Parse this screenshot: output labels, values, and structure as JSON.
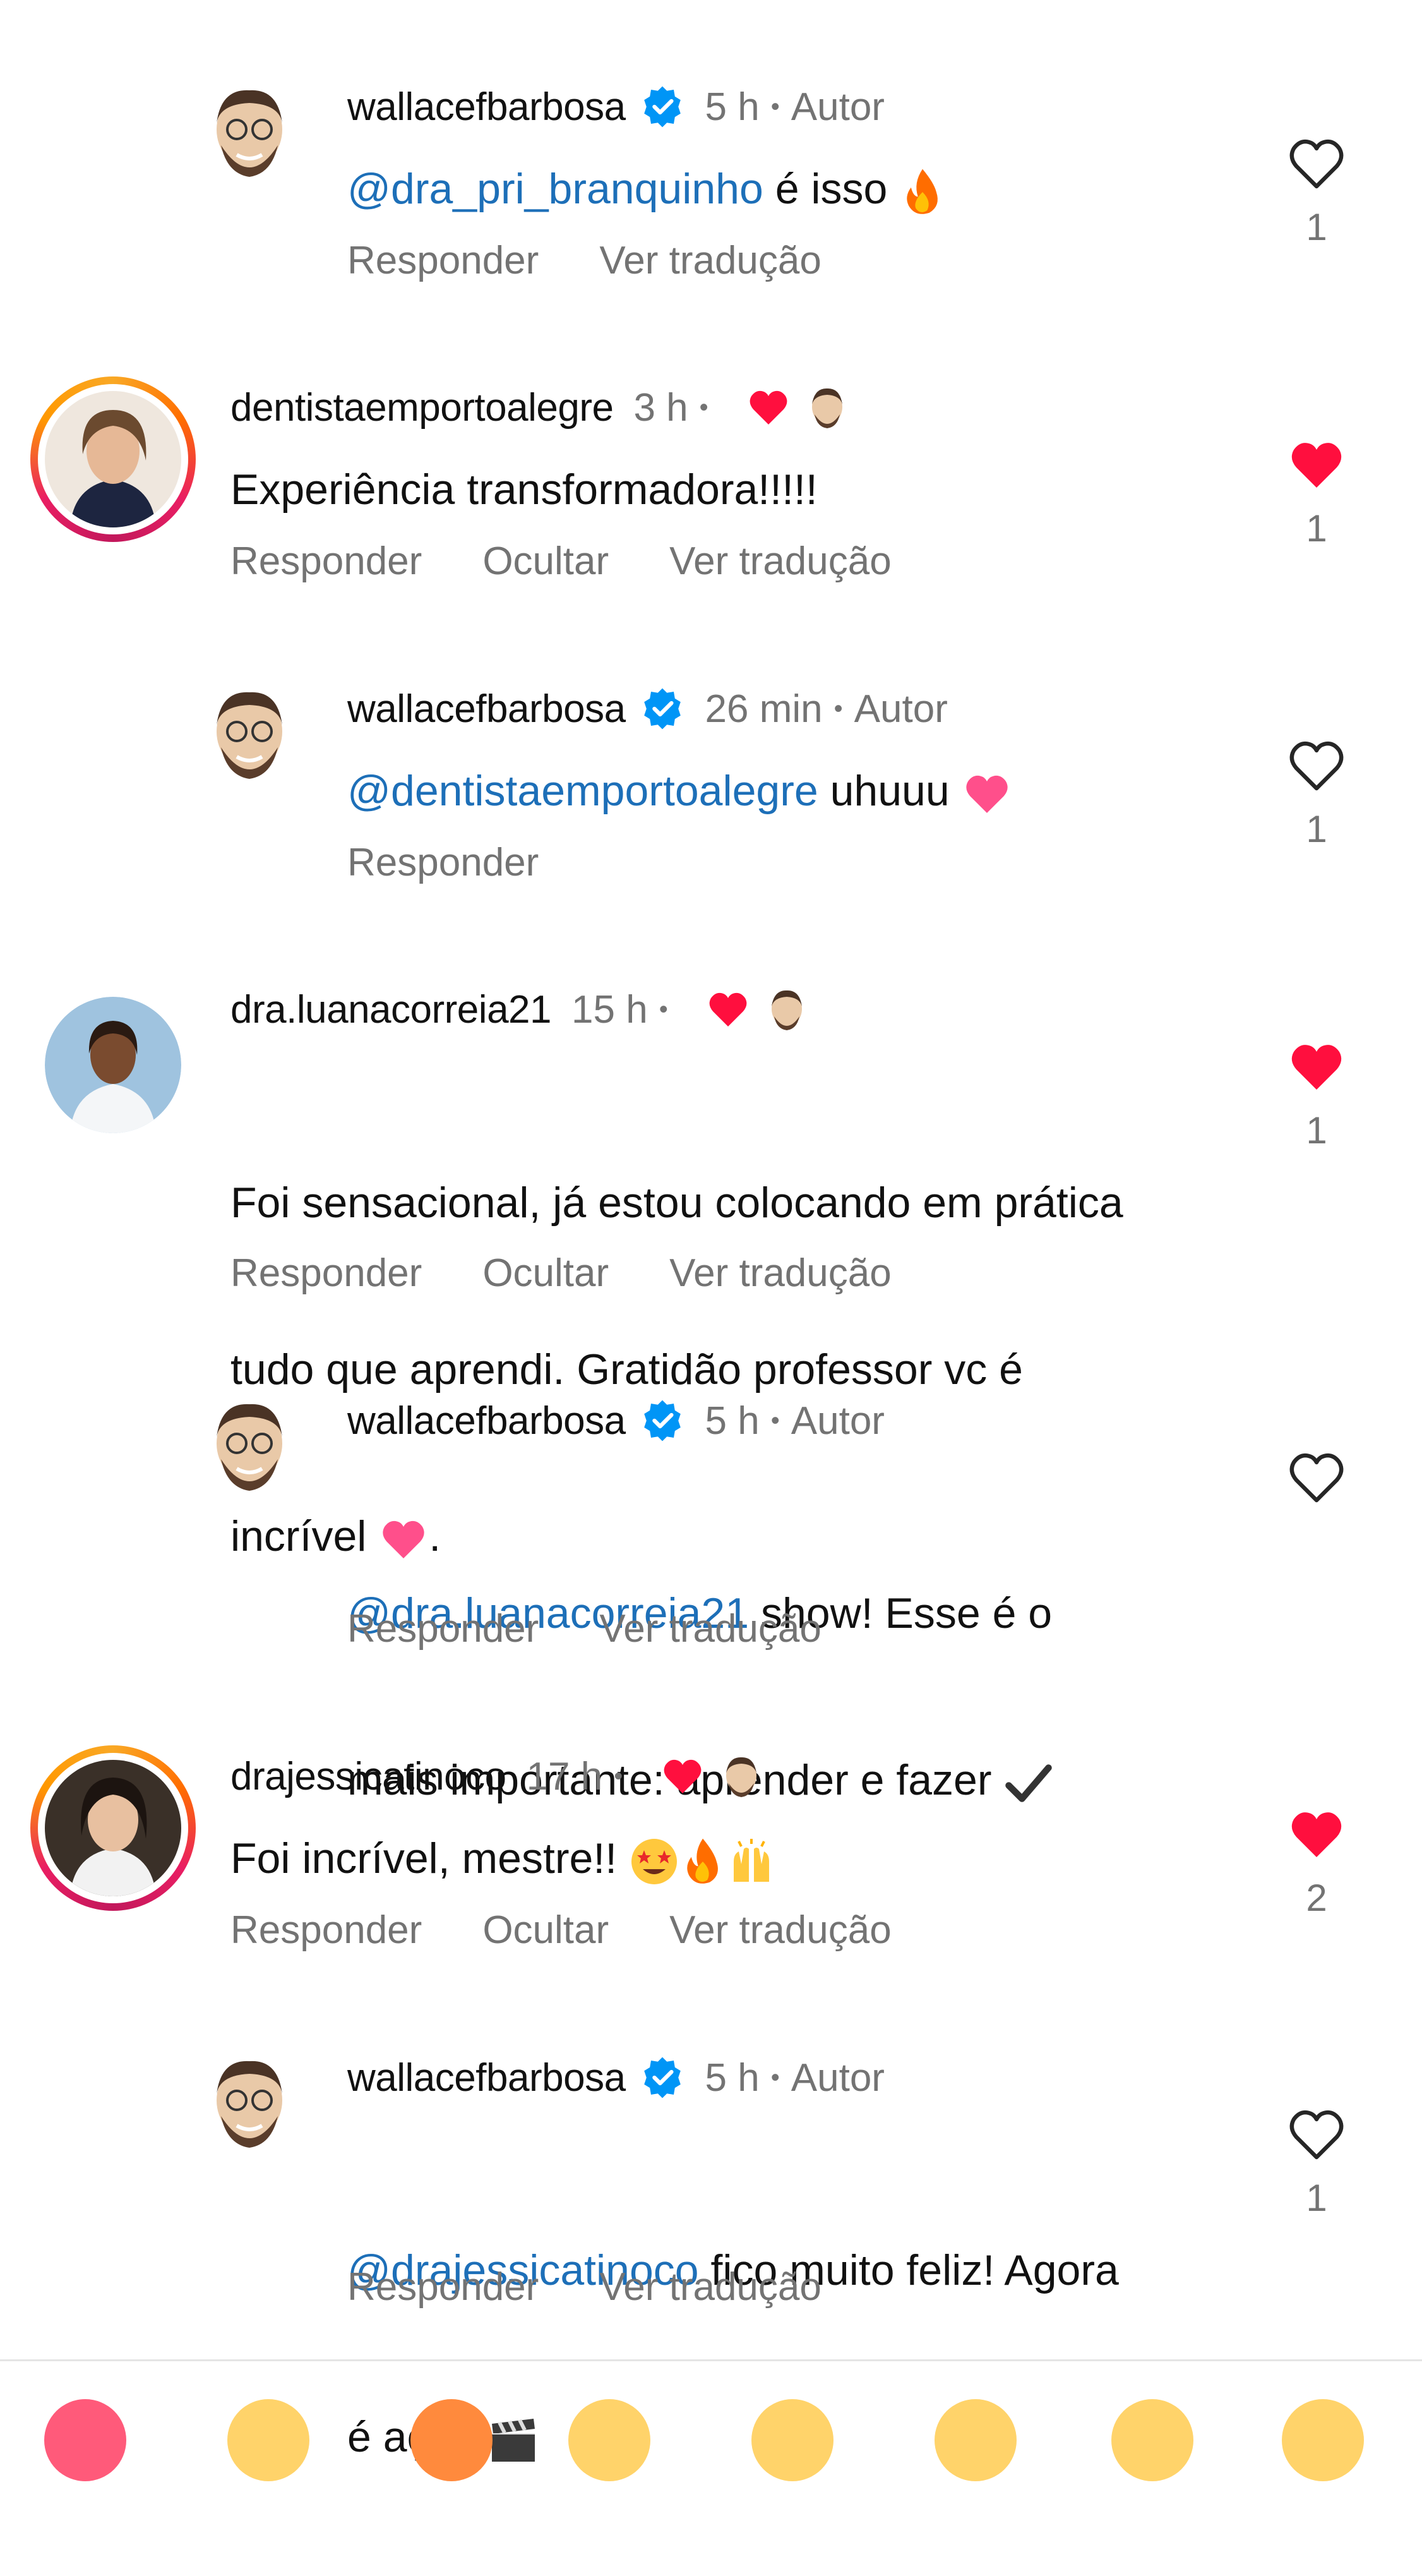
{
  "comments": [
    {
      "username": "wallacefbarbosa",
      "verified": true,
      "time": "5 h",
      "author_label": "Autor",
      "mention": "@dra_pri_branquinho",
      "text": " é isso ",
      "emoji": "fire",
      "actions": [
        "Responder",
        "Ver tradução"
      ],
      "liked": false,
      "likes": "1"
    },
    {
      "username": "dentistaemportoalegre",
      "time": "3 h",
      "text": "Experiência transformadora!!!!!",
      "actions": [
        "Responder",
        "Ocultar",
        "Ver tradução"
      ],
      "liked": true,
      "likes": "1"
    },
    {
      "username": "wallacefbarbosa",
      "verified": true,
      "time": "26 min",
      "author_label": "Autor",
      "mention": "@dentistaemportoalegre",
      "text": " uhuuu ",
      "emoji": "pink-heart",
      "actions": [
        "Responder"
      ],
      "liked": false,
      "likes": "1"
    },
    {
      "username": "dra.luanacorreia21",
      "time": "15 h",
      "text_lines": [
        "Foi sensacional, já estou colocando em prática",
        "tudo que aprendi. Gratidão professor vc é",
        "incrível "
      ],
      "text_end": ".",
      "emoji": "pink-heart",
      "actions": [
        "Responder",
        "Ocultar",
        "Ver tradução"
      ],
      "liked": true,
      "likes": "1"
    },
    {
      "username": "wallacefbarbosa",
      "verified": true,
      "time": "5 h",
      "author_label": "Autor",
      "mention": "@dra.luanacorreia21",
      "text_line1": " show! Esse é o",
      "text_line2": "mais importante: aprender e fazer ",
      "emoji": "check-mark",
      "actions": [
        "Responder",
        "Ver tradução"
      ],
      "liked": false,
      "likes": ""
    },
    {
      "username": "drajessicatinoco",
      "time": "17 h",
      "text": "Foi incrível, mestre!! ",
      "emoji": "star-eyes fire raised-hands",
      "actions": [
        "Responder",
        "Ocultar",
        "Ver tradução"
      ],
      "liked": true,
      "likes": "2"
    },
    {
      "username": "wallacefbarbosa",
      "verified": true,
      "time": "5 h",
      "author_label": "Autor",
      "mention": "@drajessicatinoco",
      "text_line1": " fico muito feliz! Agora",
      "text_line2": "é ação ",
      "emoji": "clapper-board",
      "actions": [
        "Responder",
        "Ver tradução"
      ],
      "liked": false,
      "likes": "1"
    }
  ],
  "dot": "•",
  "colors": {
    "mention": "#1d6fb8",
    "heart_red": "#ff0f3e",
    "muted": "#737373",
    "verified": "#0095f6"
  }
}
